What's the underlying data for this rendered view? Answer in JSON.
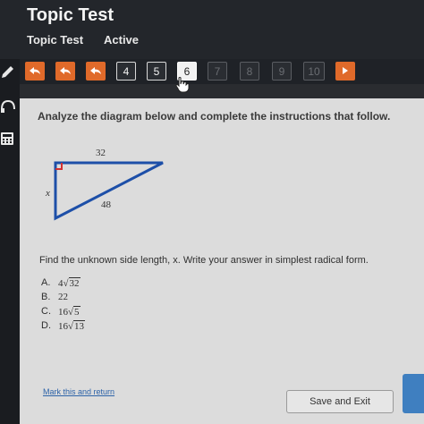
{
  "header": {
    "title": "Topic Test",
    "subtitle": "Topic Test",
    "status": "Active"
  },
  "nav": {
    "back_buttons": [
      {
        "icon": "undo-icon"
      },
      {
        "icon": "undo-icon"
      },
      {
        "icon": "undo-icon"
      }
    ],
    "numbers": [
      "4",
      "5",
      "6",
      "7",
      "8",
      "9",
      "10"
    ],
    "current": "6",
    "locked": [
      "7",
      "8",
      "9",
      "10"
    ],
    "next_icon": "play-icon"
  },
  "question": {
    "prompt": "Analyze the diagram below and complete the instructions that follow.",
    "diagram": {
      "top_label": "32",
      "left_label": "x",
      "hyp_label": "48"
    },
    "text": "Find the unknown side length, x. Write your answer in simplest radical form.",
    "choices": [
      {
        "letter": "A.",
        "coef": "4",
        "radicand": "32"
      },
      {
        "letter": "B.",
        "coef": "22",
        "radicand": ""
      },
      {
        "letter": "C.",
        "coef": "16",
        "radicand": "5"
      },
      {
        "letter": "D.",
        "coef": "16",
        "radicand": "13"
      }
    ]
  },
  "footer": {
    "mark_link": "Mark this and return",
    "save_button": "Save and Exit"
  },
  "colors": {
    "accent": "#e06a2a",
    "link": "#2d63a8",
    "triangle": "#1d4fa8",
    "right_angle": "#d43030"
  }
}
